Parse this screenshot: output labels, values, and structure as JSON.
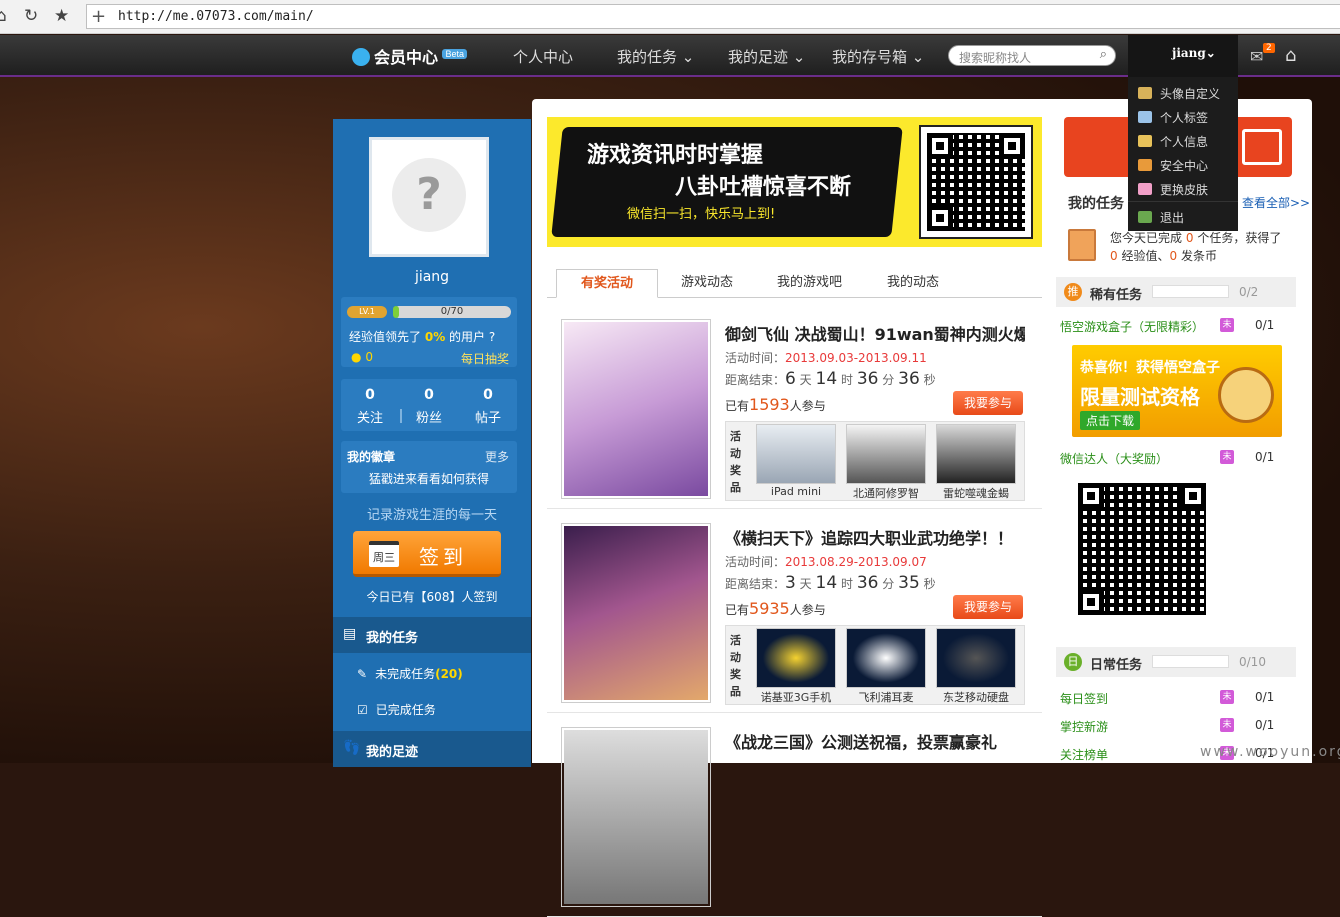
{
  "browser": {
    "url": "http://me.07073.com/main/"
  },
  "topnav": {
    "logo": "会员中心",
    "beta": "Beta",
    "items": [
      "个人中心",
      "我的任务",
      "我的足迹",
      "我的存号箱"
    ],
    "search_placeholder": "搜索昵称找人",
    "username": "jiang",
    "mail_count": "2"
  },
  "dropdown": {
    "items": [
      "头像自定义",
      "个人标签",
      "个人信息",
      "安全中心",
      "更换皮肤",
      "退出"
    ]
  },
  "profile": {
    "name": "jiang",
    "level": "LV.1",
    "exp": "0/70",
    "exp_fraction": 0,
    "exp_text_a": "经验值领先了",
    "exp_pct": "0%",
    "exp_text_b": "的用户",
    "coins": "0",
    "lottery": "每日抽奖",
    "stats": [
      {
        "value": "0",
        "label": "关注"
      },
      {
        "value": "0",
        "label": "粉丝"
      },
      {
        "value": "0",
        "label": "帖子"
      }
    ],
    "badge_title": "我的徽章",
    "badge_more": "更多",
    "badge_desc": "猛戳进来看看如何获得",
    "record": "记录游戏生涯的每一天",
    "sign_cal": "周三",
    "sign_label": "签到",
    "sign_count": "今日已有【608】人签到",
    "task_header": "我的任务",
    "task_incomplete": "未完成任务",
    "task_incomplete_count": "(20)",
    "task_complete": "已完成任务",
    "footprint_header": "我的足迹"
  },
  "banner": {
    "line1": "游戏资讯时时掌握",
    "line2": "八卦吐槽惊喜不断",
    "line3": "微信扫一扫，快乐马上到!"
  },
  "tabs": [
    "有奖活动",
    "游戏动态",
    "我的游戏吧",
    "我的动态"
  ],
  "activities": [
    {
      "title": "御剑飞仙 决战蜀山！91wan蜀神内测火爆",
      "time_label": "活动时间：",
      "time": "2013.09.03-2013.09.11",
      "cd_label": "距离结束：",
      "cd_days": "6",
      "cd_hours": "14",
      "cd_mins": "36",
      "cd_secs": "36",
      "u_day": "天",
      "u_hour": "时",
      "u_min": "分",
      "u_sec": "秒",
      "part_a": "已有",
      "participants": "1593",
      "part_b": "人参与",
      "join": "我要参与",
      "prize_label": "活动奖品",
      "prizes": [
        "iPad mini",
        "北通阿修罗智",
        "雷蛇噬魂金蝎"
      ]
    },
    {
      "title": "《横扫天下》追踪四大职业武功绝学！！",
      "time_label": "活动时间：",
      "time": "2013.08.29-2013.09.07",
      "cd_label": "距离结束：",
      "cd_days": "3",
      "cd_hours": "14",
      "cd_mins": "36",
      "cd_secs": "35",
      "u_day": "天",
      "u_hour": "时",
      "u_min": "分",
      "u_sec": "秒",
      "part_a": "已有",
      "participants": "5935",
      "part_b": "人参与",
      "join": "我要参与",
      "prize_label": "活动奖品",
      "prizes": [
        "诺基亚3G手机",
        "飞利浦耳麦",
        "东芝移动硬盘"
      ]
    },
    {
      "title": "《战龙三国》公测送祝福，投票赢豪礼"
    }
  ],
  "right": {
    "my_task": "我的任务",
    "view_all": "查看全部>>",
    "task_a": "您今天已完成",
    "task_b": "0",
    "task_c": "个任务，获得了",
    "task_d": "0",
    "task_e": "经验值、",
    "task_f": "0",
    "task_g": "发条币",
    "rare_icon": "推",
    "rare_title": "稀有任务",
    "rare_count": "0/2",
    "rare_items": [
      {
        "name": "悟空游戏盒子（无限精彩）",
        "tag": "未",
        "count": "0/1"
      },
      {
        "name": "微信达人（大奖励）",
        "tag": "未",
        "count": "0/1"
      }
    ],
    "promo_a": "恭喜你！获得悟空盒子",
    "promo_b": "限量测试资格",
    "promo_c": "点击下载",
    "daily_icon": "日",
    "daily_title": "日常任务",
    "daily_count": "0/10",
    "daily_items": [
      {
        "name": "每日签到",
        "tag": "未",
        "count": "0/1"
      },
      {
        "name": "掌控新游",
        "tag": "未",
        "count": "0/1"
      },
      {
        "name": "关注榜单",
        "tag": "未",
        "count": "0/1"
      }
    ]
  },
  "watermark": "www.wooyun.org"
}
